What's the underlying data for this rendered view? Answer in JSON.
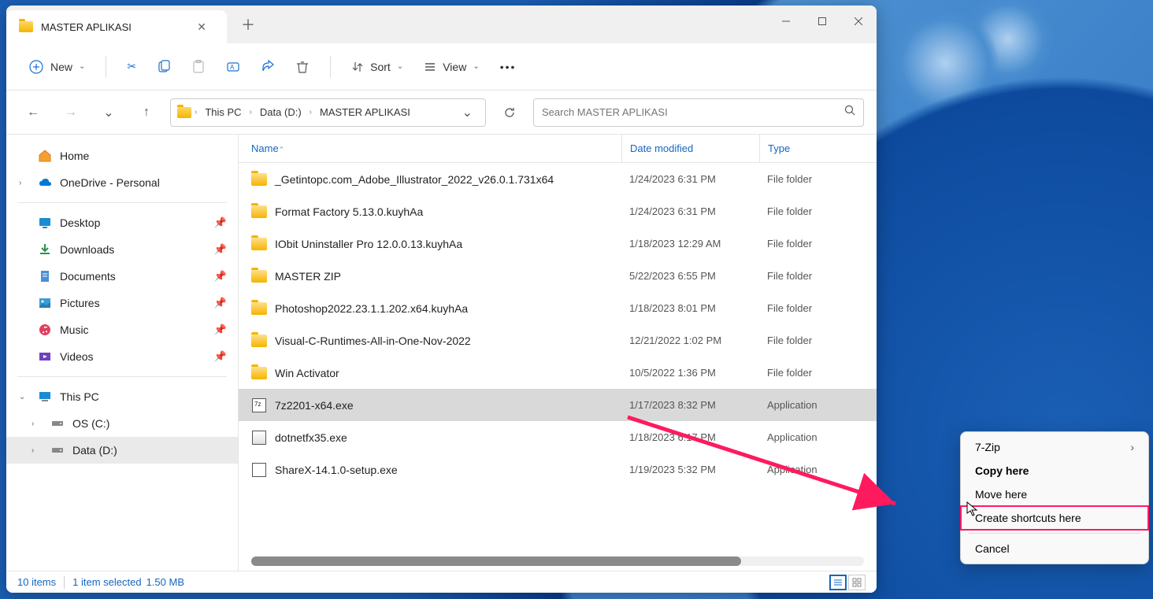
{
  "window": {
    "tab_title": "MASTER APLIKASI"
  },
  "toolbar": {
    "new_label": "New",
    "sort_label": "Sort",
    "view_label": "View"
  },
  "breadcrumb": {
    "items": [
      "This PC",
      "Data (D:)",
      "MASTER APLIKASI"
    ]
  },
  "search": {
    "placeholder": "Search MASTER APLIKASI"
  },
  "sidebar": {
    "home": "Home",
    "onedrive": "OneDrive - Personal",
    "quick": [
      "Desktop",
      "Downloads",
      "Documents",
      "Pictures",
      "Music",
      "Videos"
    ],
    "thispc": "This PC",
    "drives": [
      "OS (C:)",
      "Data (D:)"
    ]
  },
  "columns": {
    "name": "Name",
    "date": "Date modified",
    "type": "Type"
  },
  "files": [
    {
      "name": "_Getintopc.com_Adobe_Illustrator_2022_v26.0.1.731x64",
      "date": "1/24/2023 6:31 PM",
      "type": "File folder",
      "kind": "folder"
    },
    {
      "name": "Format Factory 5.13.0.kuyhAa",
      "date": "1/24/2023 6:31 PM",
      "type": "File folder",
      "kind": "folder"
    },
    {
      "name": "IObit Uninstaller Pro 12.0.0.13.kuyhAa",
      "date": "1/18/2023 12:29 AM",
      "type": "File folder",
      "kind": "folder"
    },
    {
      "name": "MASTER ZIP",
      "date": "5/22/2023 6:55 PM",
      "type": "File folder",
      "kind": "folder"
    },
    {
      "name": "Photoshop2022.23.1.1.202.x64.kuyhAa",
      "date": "1/18/2023 8:01 PM",
      "type": "File folder",
      "kind": "folder"
    },
    {
      "name": "Visual-C-Runtimes-All-in-One-Nov-2022",
      "date": "12/21/2022 1:02 PM",
      "type": "File folder",
      "kind": "folder"
    },
    {
      "name": "Win Activator",
      "date": "10/5/2022 1:36 PM",
      "type": "File folder",
      "kind": "folder"
    },
    {
      "name": "7z2201-x64.exe",
      "date": "1/17/2023 8:32 PM",
      "type": "Application",
      "kind": "exe1",
      "selected": true
    },
    {
      "name": "dotnetfx35.exe",
      "date": "1/18/2023 6:17 PM",
      "type": "Application",
      "kind": "exe2"
    },
    {
      "name": "ShareX-14.1.0-setup.exe",
      "date": "1/19/2023 5:32 PM",
      "type": "Application",
      "kind": "exe3"
    }
  ],
  "status": {
    "items": "10 items",
    "selected": "1 item selected",
    "size": "1.50 MB"
  },
  "context_menu": {
    "items": [
      "7-Zip",
      "Copy here",
      "Move here",
      "Create shortcuts here",
      "Cancel"
    ]
  }
}
